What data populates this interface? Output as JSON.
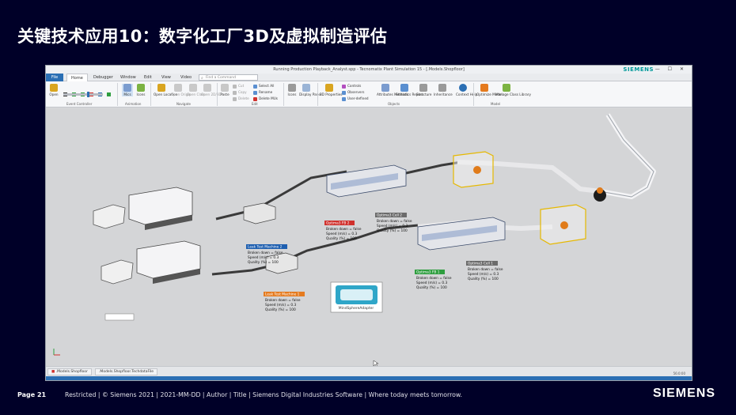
{
  "slide": {
    "title": "关键技术应用10：数字化工厂3D及虚拟制造评估",
    "page": "Page 21",
    "footer": "Restricted | © Siemens 2021 | 2021-MM-DD | Author | Title | Siemens Digital Industries Software | Where today meets tomorrow.",
    "brand": "SIEMENS"
  },
  "app": {
    "title": "Running Production Playback_Analyst.spp - Tecnomatix Plant Simulation 15 - [.Models.Shopfloor]",
    "brand": "SIEMENS",
    "window_controls": "— ☐ ✕"
  },
  "menu": {
    "file": "File",
    "home": "Home",
    "debugger": "Debugger",
    "window": "Window",
    "edit": "Edit",
    "view": "View",
    "video": "Video",
    "find_placeholder": "Find a Command"
  },
  "ribbon": {
    "open": "Open",
    "event_controller": "Event Controller",
    "mics": "Mics",
    "icons": "Icons",
    "animation": "Animation",
    "open_location": "Open Location",
    "open_origin": "Open Origin",
    "open_class": "Open Class",
    "open_2d3d": "Open 2D/3D",
    "navigate": "Navigate",
    "paste": "Paste",
    "cut": "Cut",
    "copy": "Copy",
    "delete": "Delete",
    "select_all": "Select All",
    "rename": "Rename",
    "delete_mus": "Delete MUs",
    "edit": "Edit",
    "icons_btn": "Icons",
    "display_panel": "Display Panel",
    "properties_3d": "3D Properties",
    "controls": "Controls",
    "observers": "Observers",
    "user_defined": "User-defined",
    "attributes_methods": "Attributes Methods",
    "statistics_report": "Statistics Report",
    "structure": "Structure",
    "inheritance": "Inheritance",
    "context_help": "Context Help",
    "objects": "Objects",
    "optimize_model": "Optimize Model",
    "manage_class_library": "Manage Class Library",
    "model": "Model"
  },
  "machines": [
    {
      "name": "Leak Test Machine 2",
      "color": "#1e5fb0",
      "broken": "Broken down = false",
      "speed": "Speed (m/s) = 0.3",
      "quality": "Quality (%) = 100"
    },
    {
      "name": "Leak Test Machine 1",
      "color": "#e57b1f",
      "broken": "Broken down = false",
      "speed": "Speed (m/s) = 0.3",
      "quality": "Quality (%) = 100"
    },
    {
      "name": "Optima3 FB 2",
      "color": "#d0312d",
      "broken": "Broken down = false",
      "speed": "Speed (m/s) = 0.3",
      "quality": "Quality (%) = 100"
    },
    {
      "name": "Optima3 Cell 2",
      "color": "#6b6b6b",
      "broken": "Broken down = false",
      "speed": "Speed (m/s) = 0.3",
      "quality": "Quality (%) = 100"
    },
    {
      "name": "Optima3 FB 1",
      "color": "#2e9e3f",
      "broken": "Broken down = false",
      "speed": "Speed (m/s) = 0.3",
      "quality": "Quality (%) = 100"
    },
    {
      "name": "Optima3 Cell 1",
      "color": "#6b6b6b",
      "broken": "Broken down = false",
      "speed": "Speed (m/s) = 0.3",
      "quality": "Quality (%) = 100"
    }
  ],
  "adapter": "MindSphereAdapter",
  "status": {
    "tab1": ".Models.Shopfloor",
    "tab2": ".Models.Shopfloor.TechdataFile",
    "zoom": "56:0:00"
  }
}
